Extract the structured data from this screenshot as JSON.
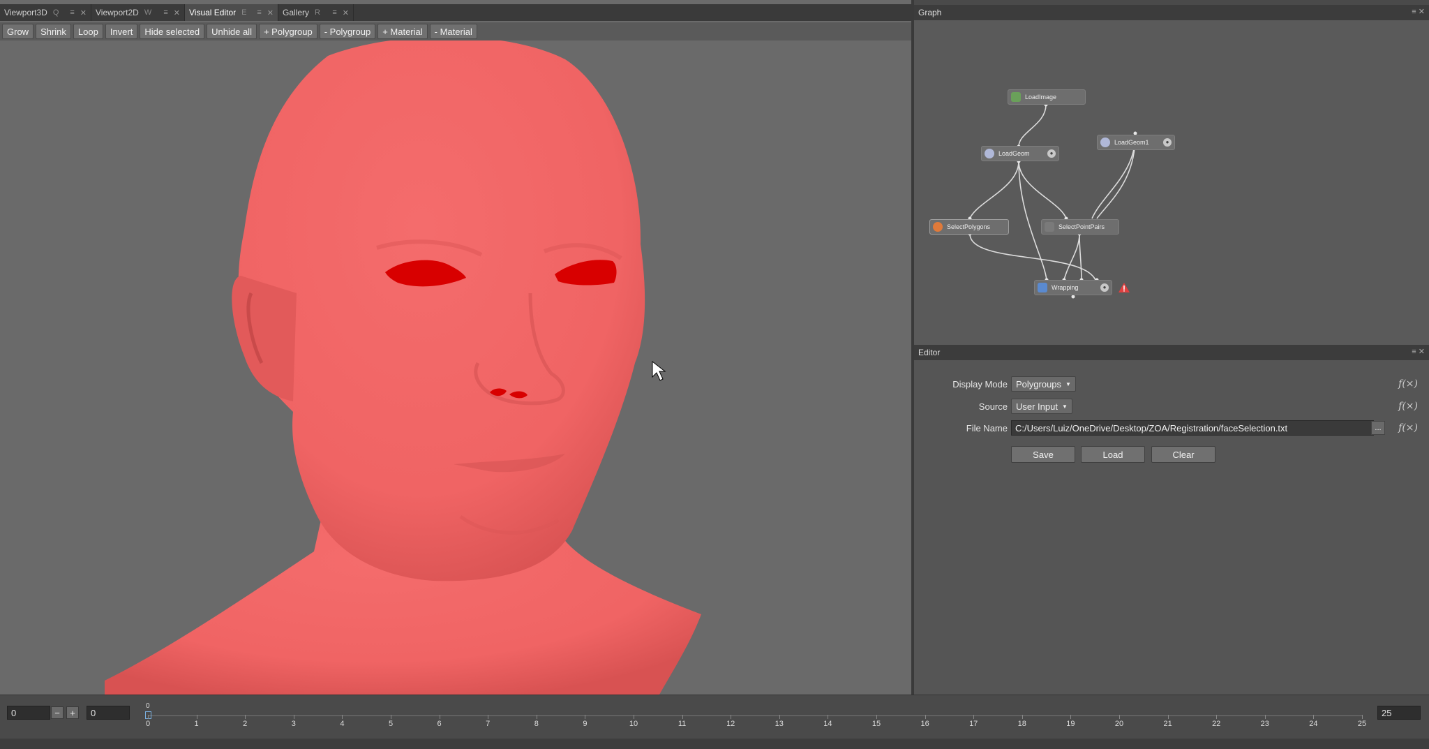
{
  "tabs": [
    {
      "label": "Viewport3D",
      "shortcut": "Q"
    },
    {
      "label": "Viewport2D",
      "shortcut": "W"
    },
    {
      "label": "Visual Editor",
      "shortcut": "E"
    },
    {
      "label": "Gallery",
      "shortcut": "R"
    }
  ],
  "toolbar": {
    "buttons": [
      "Grow",
      "Shrink",
      "Loop",
      "Invert",
      "Hide selected",
      "Unhide all",
      "+ Polygroup",
      "- Polygroup",
      "+ Material",
      "- Material"
    ]
  },
  "graph": {
    "title": "Graph",
    "nodes": {
      "load_image": "LoadImage",
      "load_geom": "LoadGeom",
      "load_geom1": "LoadGeom1",
      "select_polygons": "SelectPolygons",
      "select_point_pairs": "SelectPointPairs",
      "wrapping": "Wrapping"
    }
  },
  "editor": {
    "title": "Editor",
    "display_mode": {
      "label": "Display Mode",
      "value": "Polygroups"
    },
    "source": {
      "label": "Source",
      "value": "User Input"
    },
    "file_name": {
      "label": "File Name",
      "value": "C:/Users/Luiz/OneDrive/Desktop/ZOA/Registration/faceSelection.txt",
      "browse": "..."
    },
    "fx": "f(×)",
    "buttons": {
      "save": "Save",
      "load": "Load",
      "clear": "Clear"
    }
  },
  "timeline": {
    "start_frame": "0",
    "current_frame": "0",
    "end_frame": "25",
    "marker": "0",
    "ticks": [
      "0",
      "1",
      "2",
      "3",
      "4",
      "5",
      "6",
      "7",
      "8",
      "9",
      "10",
      "11",
      "12",
      "13",
      "14",
      "15",
      "16",
      "17",
      "18",
      "19",
      "20",
      "21",
      "22",
      "23",
      "24",
      "25"
    ]
  },
  "colors": {
    "mesh": "#f26363",
    "selected": "#d80000"
  }
}
